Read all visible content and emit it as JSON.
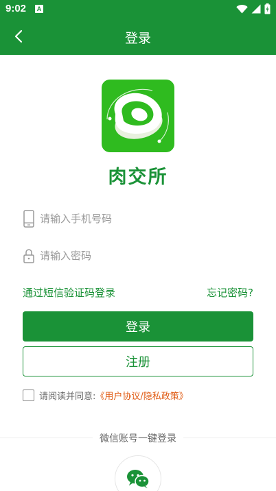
{
  "status_bar": {
    "time": "9:02",
    "notification_badge": "A"
  },
  "header": {
    "title": "登录",
    "back_icon": "chevron-left-icon"
  },
  "app": {
    "name": "肉交所",
    "logo_icon": "app-logo-icon"
  },
  "form": {
    "phone": {
      "placeholder": "请输入手机号码",
      "value": "",
      "icon": "phone-icon"
    },
    "password": {
      "placeholder": "请输入密码",
      "value": "",
      "icon": "lock-icon"
    }
  },
  "links": {
    "sms_login": "通过短信验证码登录",
    "forgot_password": "忘记密码?"
  },
  "buttons": {
    "login": "登录",
    "register": "注册"
  },
  "agreement": {
    "prefix": "请阅读并同意:",
    "link": "《用户协议/隐私政策》",
    "checked": false
  },
  "wechat": {
    "title": "微信账号一键登录",
    "icon": "wechat-icon"
  },
  "colors": {
    "primary": "#1a9237",
    "logo_green": "#2fbb1f",
    "agreement_link": "#e05a12",
    "placeholder": "#9a9a9a"
  }
}
